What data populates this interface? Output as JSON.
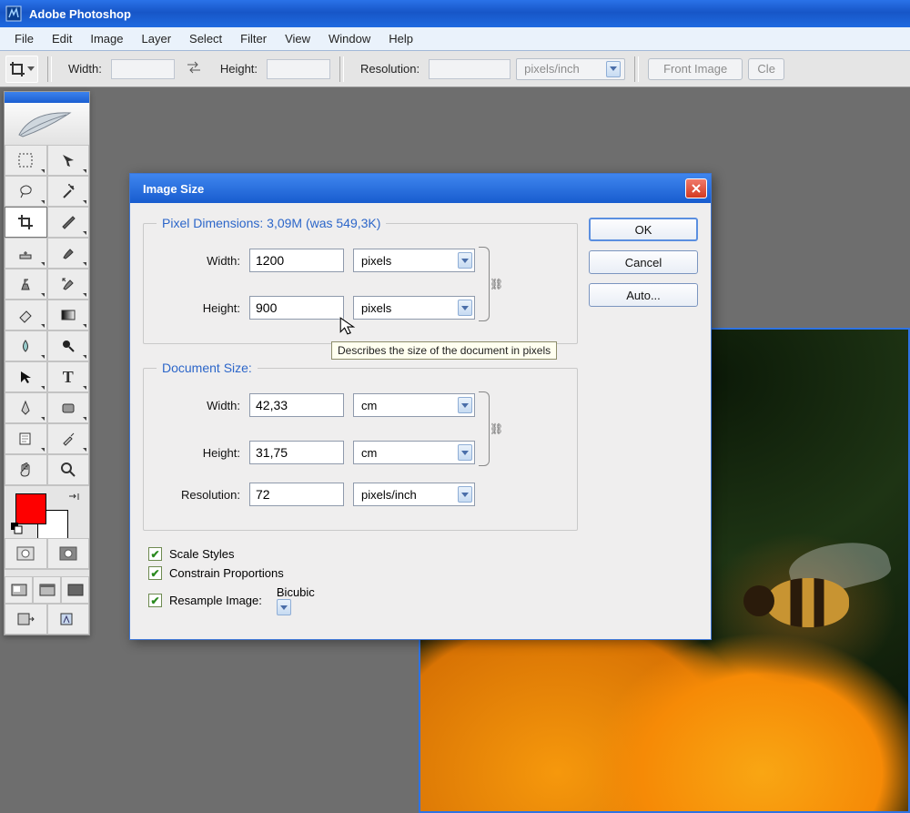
{
  "titlebar": {
    "title": "Adobe Photoshop"
  },
  "menu": {
    "items": [
      "File",
      "Edit",
      "Image",
      "Layer",
      "Select",
      "Filter",
      "View",
      "Window",
      "Help"
    ]
  },
  "optbar": {
    "width_label": "Width:",
    "height_label": "Height:",
    "res_label": "Resolution:",
    "res_unit": "pixels/inch",
    "front_btn": "Front Image",
    "clear_btn": "Cle"
  },
  "dialog": {
    "title": "Image Size",
    "ok": "OK",
    "cancel": "Cancel",
    "auto": "Auto...",
    "pixel_legend": "Pixel Dimensions:  3,09M (was 549,3K)",
    "px_width_label": "Width:",
    "px_width_val": "1200",
    "px_width_unit": "pixels",
    "px_height_label": "Height:",
    "px_height_val": "900",
    "px_height_unit": "pixels",
    "doc_legend": "Document Size:",
    "doc_width_label": "Width:",
    "doc_width_val": "42,33",
    "doc_width_unit": "cm",
    "doc_height_label": "Height:",
    "doc_height_val": "31,75",
    "doc_height_unit": "cm",
    "doc_res_label": "Resolution:",
    "doc_res_val": "72",
    "doc_res_unit": "pixels/inch",
    "chk_scale": "Scale Styles",
    "chk_constrain": "Constrain Proportions",
    "chk_resample": "Resample Image:",
    "resample_method": "Bicubic",
    "tooltip": "Describes the size of the document in pixels"
  },
  "tools": {
    "list": [
      "rect-marquee-icon",
      "move-icon",
      "lasso-icon",
      "magic-wand-icon",
      "crop-icon",
      "slice-icon",
      "healing-brush-icon",
      "brush-icon",
      "clone-stamp-icon",
      "history-brush-icon",
      "eraser-icon",
      "gradient-icon",
      "blur-icon",
      "dodge-icon",
      "path-select-icon",
      "type-icon",
      "pen-icon",
      "shape-icon",
      "notes-icon",
      "eyedropper-icon",
      "hand-icon",
      "zoom-icon"
    ]
  }
}
